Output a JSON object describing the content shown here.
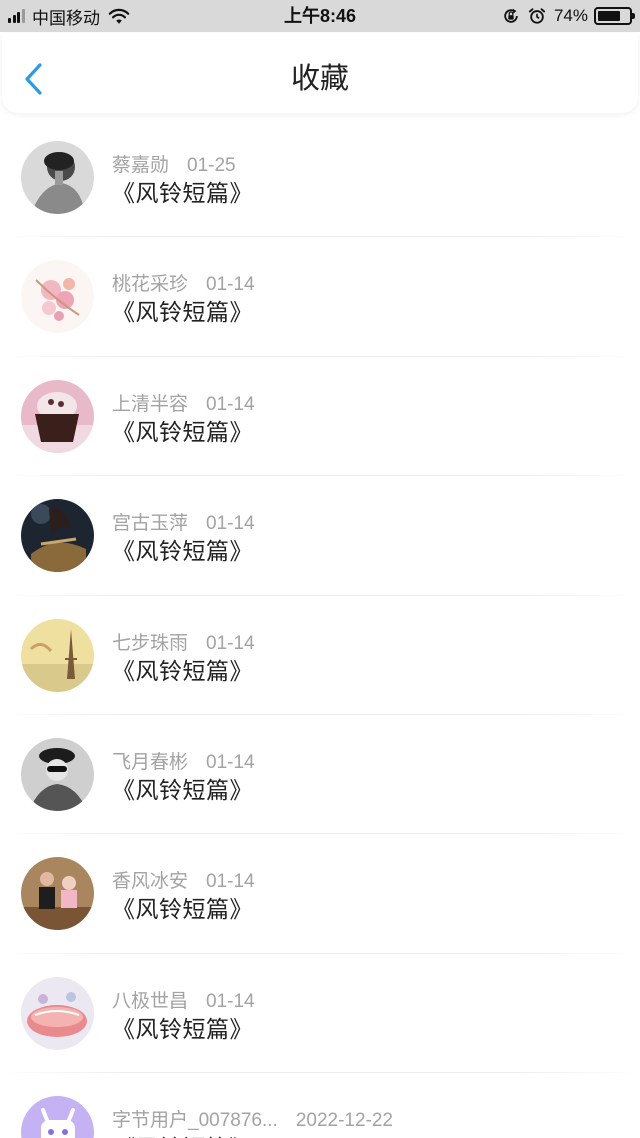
{
  "status_bar": {
    "carrier": "中国移动",
    "time": "上午8:46",
    "battery_percent": "74%",
    "battery_level": 0.74
  },
  "nav": {
    "title": "收藏",
    "back_icon": "chevron-left-icon",
    "accent_color": "#2b9ae8"
  },
  "favorites": [
    {
      "author": "蔡嘉勋",
      "date": "01-25",
      "title": "《风铃短篇》"
    },
    {
      "author": "桃花采珍",
      "date": "01-14",
      "title": "《风铃短篇》"
    },
    {
      "author": "上清半容",
      "date": "01-14",
      "title": "《风铃短篇》"
    },
    {
      "author": "宫古玉萍",
      "date": "01-14",
      "title": "《风铃短篇》"
    },
    {
      "author": "七步珠雨",
      "date": "01-14",
      "title": "《风铃短篇》"
    },
    {
      "author": "飞月春彬",
      "date": "01-14",
      "title": "《风铃短篇》"
    },
    {
      "author": "香风冰安",
      "date": "01-14",
      "title": "《风铃短篇》"
    },
    {
      "author": "八极世昌",
      "date": "01-14",
      "title": "《风铃短篇》"
    },
    {
      "author": "字节用户_007876...",
      "date": "2022-12-22",
      "title": "《风铃短篇》"
    }
  ]
}
